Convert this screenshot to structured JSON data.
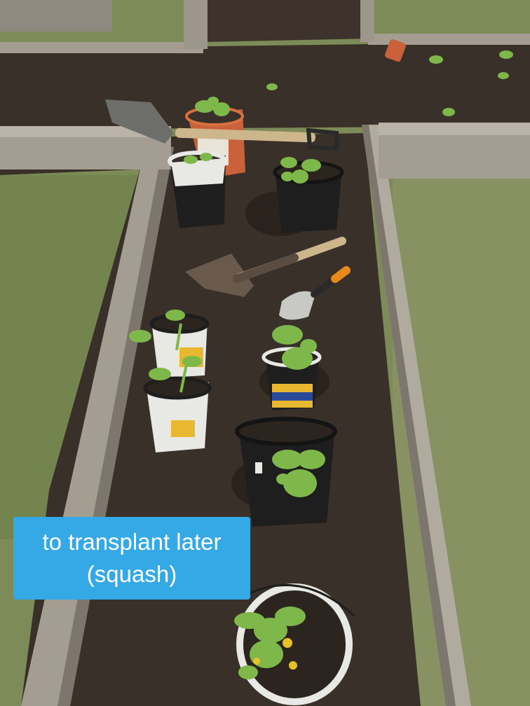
{
  "photo": {
    "subject": "raised-bed garden with potted seedlings awaiting transplant",
    "caption_lines": [
      "to transplant later",
      "(squash)"
    ],
    "colors": {
      "soil": "#3a302a",
      "soil_dark": "#2a221d",
      "wood": "#a39d92",
      "wood_shadow": "#7c766d",
      "grass": "#7d8b58",
      "caption_bg": "#35a8e6",
      "caption_text": "#ffffff",
      "leaf": "#7fb84a",
      "leaf_dark": "#4f8a2e",
      "pot_black": "#1e1e1e",
      "pot_white": "#e8e8e4",
      "pot_terracotta": "#c9623a",
      "handle_wood": "#cdb58c",
      "handle_orange": "#e8891c"
    },
    "icons": [
      "shovel-icon",
      "trowel-icon",
      "scoop-icon",
      "flower-pot-icon",
      "seedling-icon"
    ]
  }
}
